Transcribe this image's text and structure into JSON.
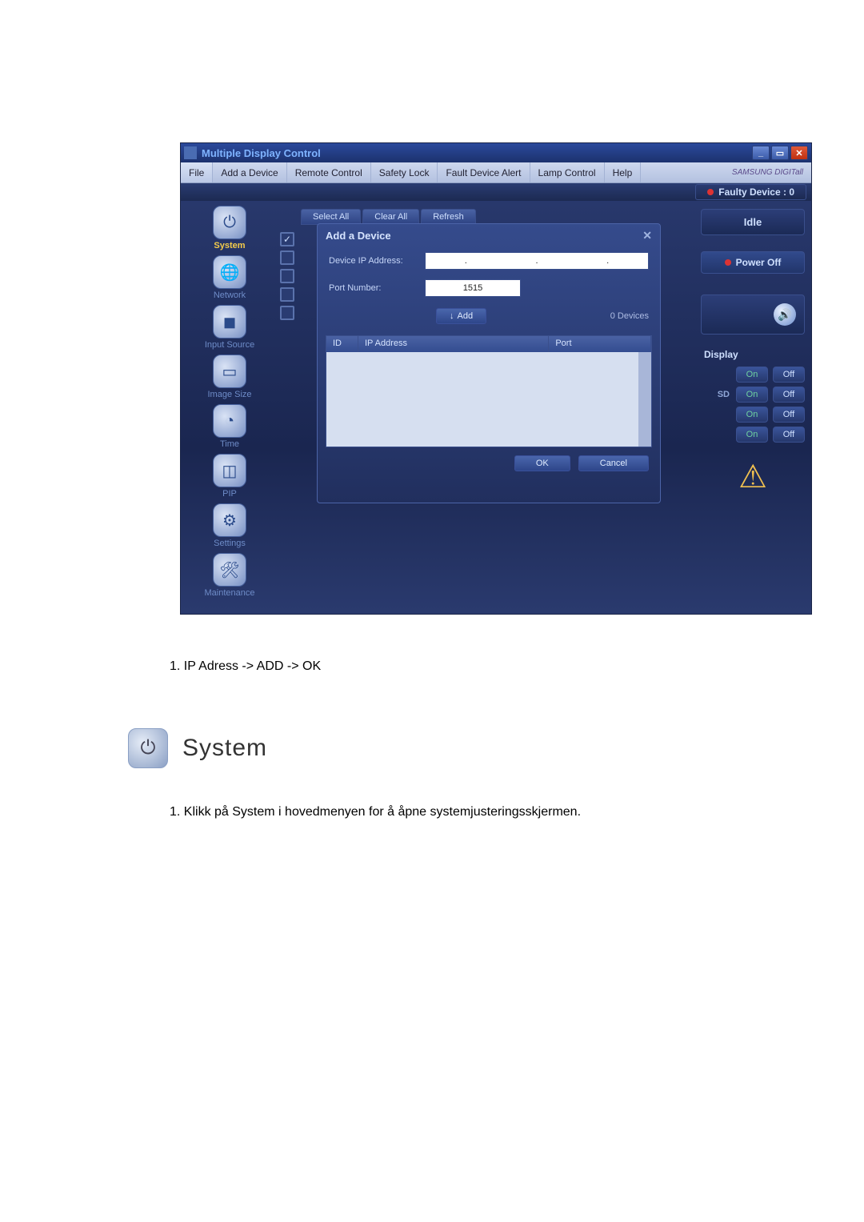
{
  "window": {
    "title": "Multiple Display Control",
    "brand": "SAMSUNG DIGITall"
  },
  "menu": {
    "file": "File",
    "add_device": "Add a Device",
    "remote_control": "Remote Control",
    "safety_lock": "Safety Lock",
    "fault_alert": "Fault Device Alert",
    "lamp_control": "Lamp Control",
    "help": "Help"
  },
  "status_bar": {
    "faulty": "Faulty Device : 0"
  },
  "tabs": {
    "select_all": "Select All",
    "clear_all": "Clear All",
    "refresh": "Refresh"
  },
  "sidebar": {
    "system": "System",
    "network": "Network",
    "input_source": "Input Source",
    "image_size": "Image Size",
    "time": "Time",
    "pip": "PIP",
    "settings": "Settings",
    "maintenance": "Maintenance"
  },
  "right": {
    "idle": "Idle",
    "power_off": "Power Off",
    "display": "Display",
    "sd": "SD",
    "on": "On",
    "off": "Off"
  },
  "modal": {
    "title": "Add a Device",
    "ip_label": "Device IP Address:",
    "port_label": "Port Number:",
    "port_value": "1515",
    "add": "Add",
    "devices_count": "0 Devices",
    "col_id": "ID",
    "col_ip": "IP Address",
    "col_port": "Port",
    "ok": "OK",
    "cancel": "Cancel"
  },
  "doc": {
    "step1": "1. IP Adress ->  ADD ->  OK",
    "section_heading": "System",
    "step2": "1. Klikk på System i hovedmenyen for å åpne systemjusteringsskjermen."
  }
}
